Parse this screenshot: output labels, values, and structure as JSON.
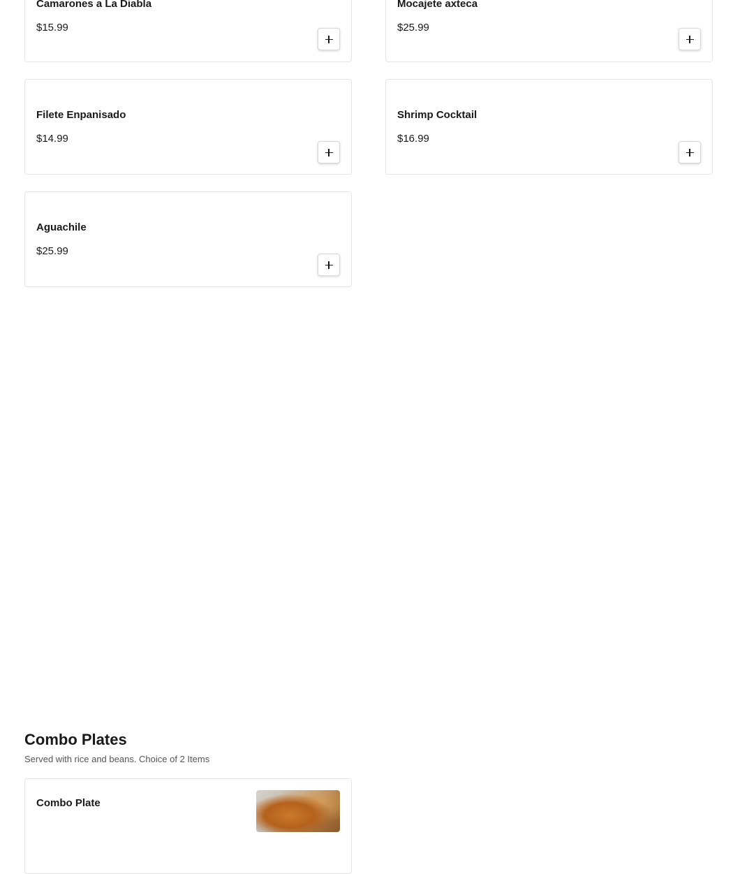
{
  "items": [
    {
      "name": "Camarones a La Diabla",
      "price": "$15.99"
    },
    {
      "name": "Mocajete axteca",
      "price": "$25.99"
    },
    {
      "name": "Filete Enpanisado",
      "price": "$14.99"
    },
    {
      "name": "Shrimp Cocktail",
      "price": "$16.99"
    },
    {
      "name": "Aguachile",
      "price": "$25.99"
    }
  ],
  "combo_section": {
    "title": "Combo Plates",
    "description": "Served with rice and beans. Choice of 2 Items",
    "items": [
      {
        "name": "Combo Plate"
      }
    ]
  },
  "icons": {
    "add": "plus-icon"
  }
}
